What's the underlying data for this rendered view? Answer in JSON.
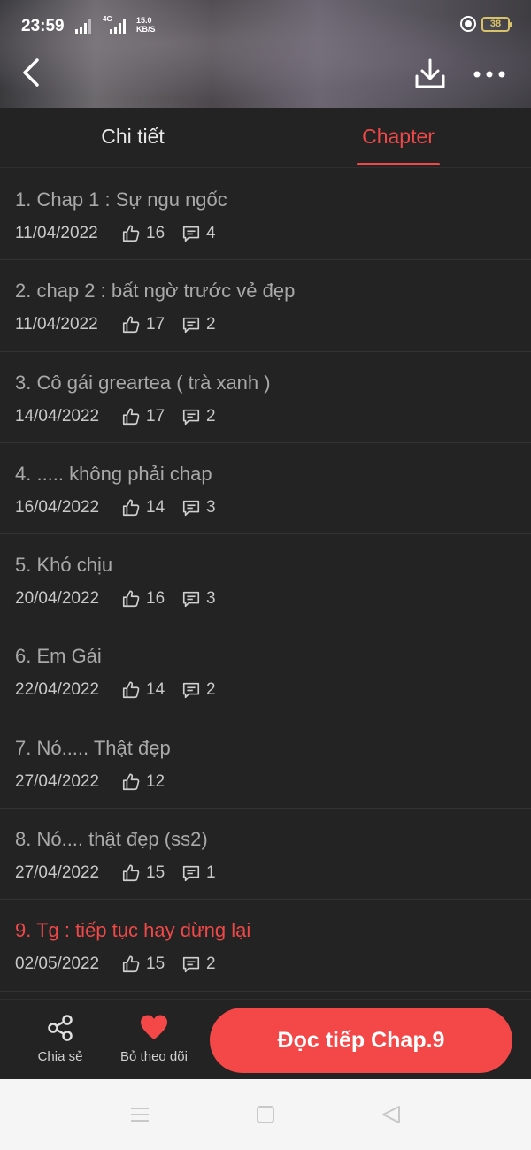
{
  "status_bar": {
    "time": "23:59",
    "network": "4G",
    "speed_value": "15.0",
    "speed_unit": "KB/S",
    "battery": "38"
  },
  "top_bar": {
    "back_icon": "chevron-left-icon",
    "download_icon": "download-icon",
    "more_icon": "more-horizontal-icon"
  },
  "tabs": [
    {
      "label": "Chi tiết",
      "active": false
    },
    {
      "label": "Chapter",
      "active": true
    }
  ],
  "chapters": [
    {
      "title": "1. Chap 1 : Sự ngu ngốc",
      "date": "11/04/2022",
      "likes": "16",
      "comments": "4",
      "current": false
    },
    {
      "title": "2. chap 2 : bất ngờ trước vẻ đẹp",
      "date": "11/04/2022",
      "likes": "17",
      "comments": "2",
      "current": false
    },
    {
      "title": "3. Cô gái greartea ( trà xanh )",
      "date": "14/04/2022",
      "likes": "17",
      "comments": "2",
      "current": false
    },
    {
      "title": "4. ..... không phải chap",
      "date": "16/04/2022",
      "likes": "14",
      "comments": "3",
      "current": false
    },
    {
      "title": "5. Khó chịu",
      "date": "20/04/2022",
      "likes": "16",
      "comments": "3",
      "current": false
    },
    {
      "title": "6. Em Gái",
      "date": "22/04/2022",
      "likes": "14",
      "comments": "2",
      "current": false
    },
    {
      "title": "7. Nó..... Thật đẹp",
      "date": "27/04/2022",
      "likes": "12",
      "comments": null,
      "current": false
    },
    {
      "title": "8. Nó.... thật đẹp (ss2)",
      "date": "27/04/2022",
      "likes": "15",
      "comments": "1",
      "current": false
    },
    {
      "title": "9. Tg : tiếp tục hay dừng lại",
      "date": "02/05/2022",
      "likes": "15",
      "comments": "2",
      "current": true
    }
  ],
  "bottom_bar": {
    "share_label": "Chia sẻ",
    "unfollow_label": "Bỏ theo dõi",
    "continue_label": "Đọc tiếp Chap.9"
  },
  "colors": {
    "accent": "#f04848",
    "button": "#f44747",
    "background": "#232323"
  }
}
